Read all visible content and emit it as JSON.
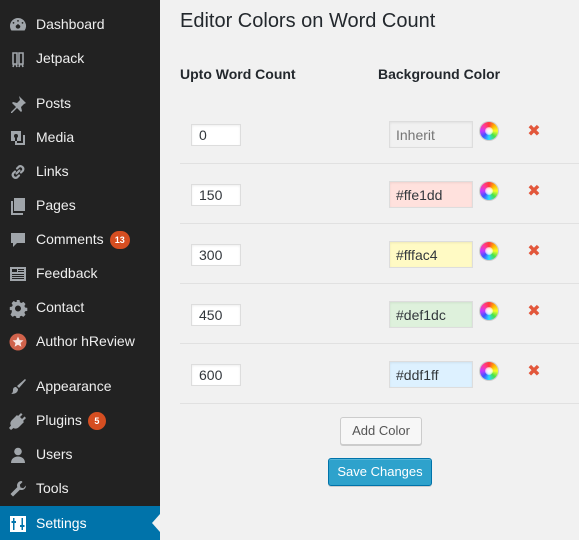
{
  "sidebar": {
    "items": [
      {
        "label": "Dashboard",
        "icon": "dashboard-icon"
      },
      {
        "label": "Jetpack",
        "icon": "jetpack-icon"
      },
      {
        "label": "Posts",
        "icon": "pushpin-icon"
      },
      {
        "label": "Media",
        "icon": "media-icon"
      },
      {
        "label": "Links",
        "icon": "link-icon"
      },
      {
        "label": "Pages",
        "icon": "pages-icon"
      },
      {
        "label": "Comments",
        "icon": "comment-icon",
        "badge": "13"
      },
      {
        "label": "Feedback",
        "icon": "feedback-icon"
      },
      {
        "label": "Contact",
        "icon": "gear-icon"
      },
      {
        "label": "Author hReview",
        "icon": "star-icon"
      },
      {
        "label": "Appearance",
        "icon": "paintbrush-icon"
      },
      {
        "label": "Plugins",
        "icon": "plugin-icon",
        "badge": "5"
      },
      {
        "label": "Users",
        "icon": "user-icon"
      },
      {
        "label": "Tools",
        "icon": "wrench-icon"
      },
      {
        "label": "Settings",
        "icon": "settings-icon",
        "current": true
      }
    ]
  },
  "page": {
    "title": "Editor Colors on Word Count",
    "columns": {
      "word_count": "Upto Word Count",
      "background": "Background Color"
    }
  },
  "rows": [
    {
      "count": "0",
      "color_value": "",
      "color_placeholder": "Inherit",
      "bg": "#f1f1f1"
    },
    {
      "count": "150",
      "color_value": "#ffe1dd",
      "color_placeholder": "",
      "bg": "#ffe1dd"
    },
    {
      "count": "300",
      "color_value": "#fffac4",
      "color_placeholder": "",
      "bg": "#fffac4"
    },
    {
      "count": "450",
      "color_value": "#def1dc",
      "color_placeholder": "",
      "bg": "#def1dc"
    },
    {
      "count": "600",
      "color_value": "#ddf1ff",
      "color_placeholder": "",
      "bg": "#ddf1ff"
    }
  ],
  "buttons": {
    "add_color": "Add Color",
    "save_changes": "Save Changes"
  },
  "colors": {
    "sidebar_bg": "#222222",
    "current_bg": "#0073aa",
    "badge": "#d54e21",
    "remove": "#e2573b",
    "primary_button": "#2ea2cc"
  }
}
